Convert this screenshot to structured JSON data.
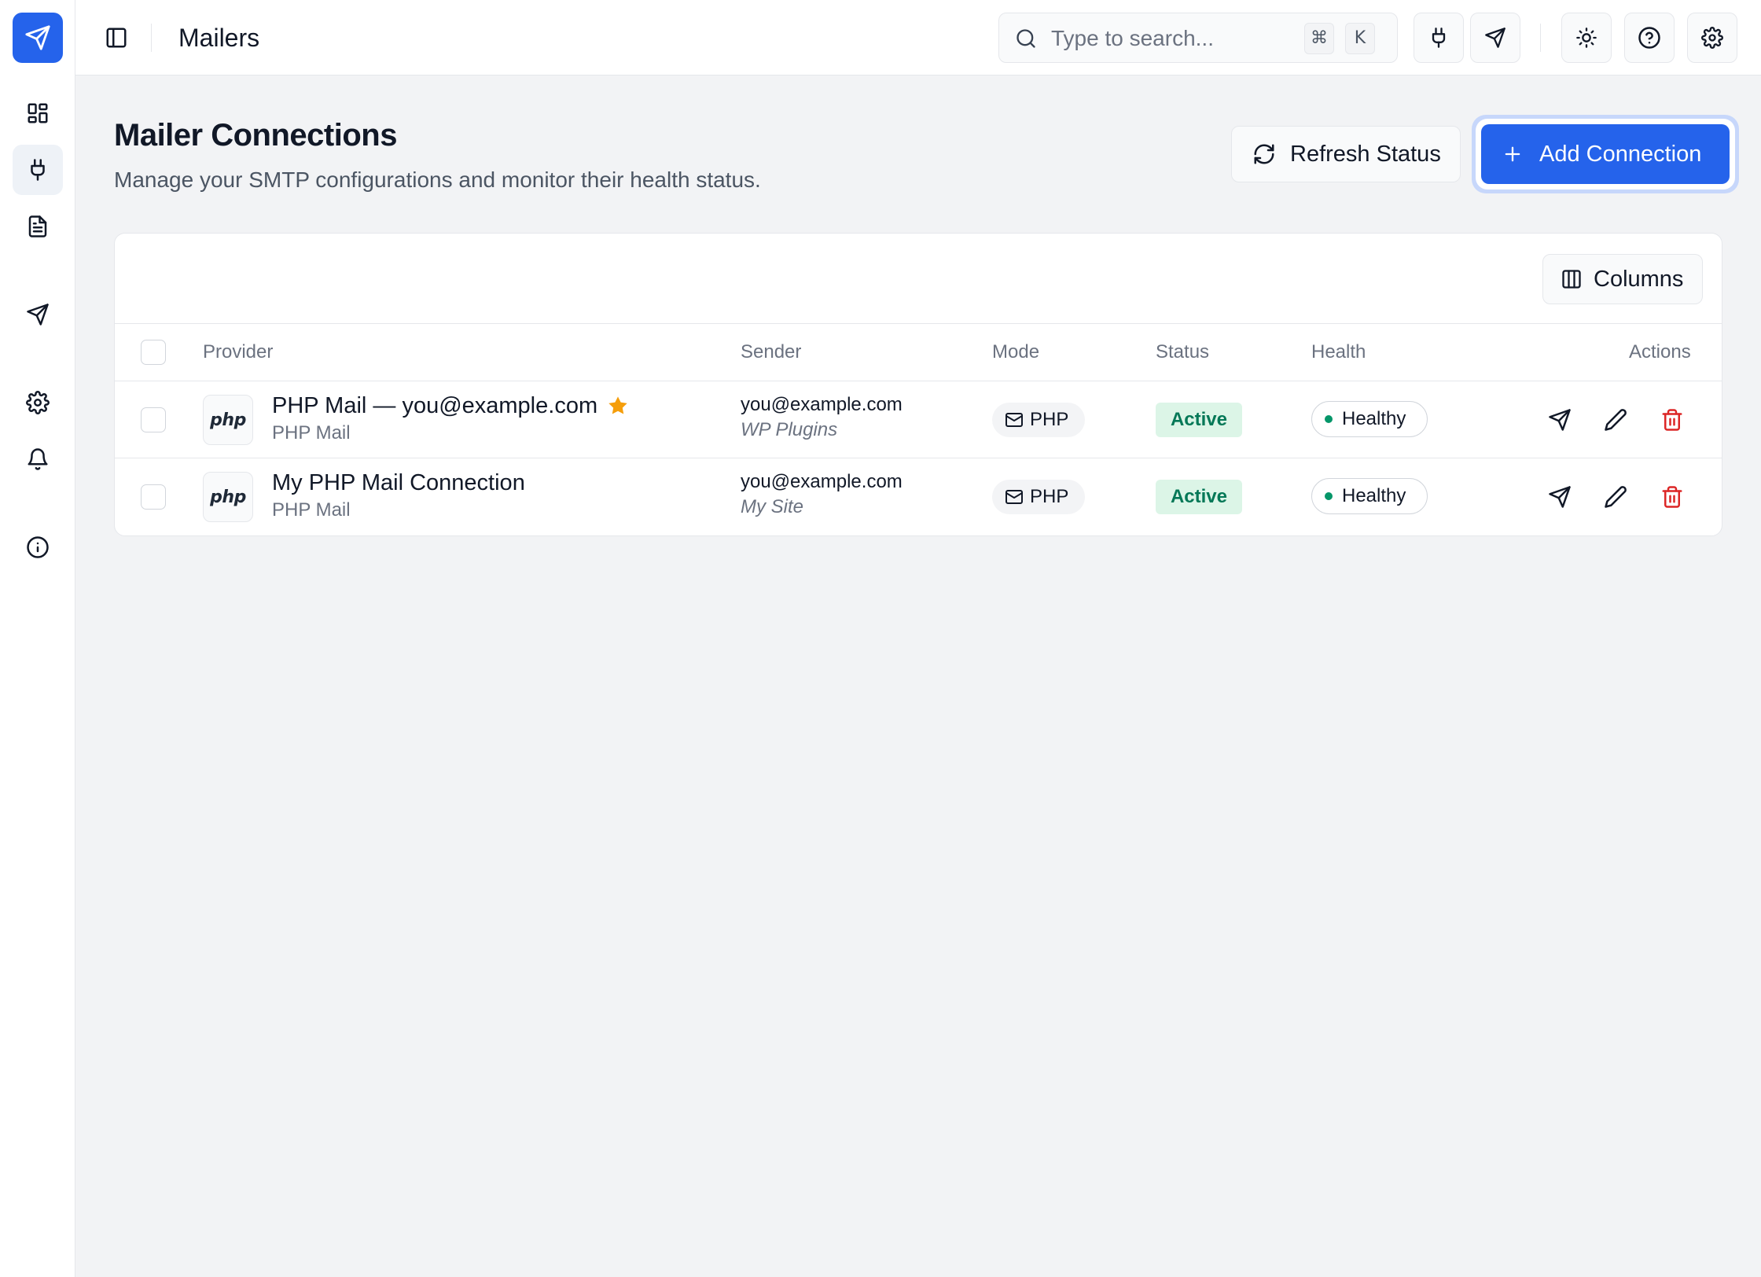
{
  "app": {
    "page_title": "Mailers"
  },
  "sidebar": {
    "items": [
      {
        "name": "dashboard",
        "icon": "dashboard-icon",
        "active": false
      },
      {
        "name": "connections",
        "icon": "plug-icon",
        "active": true
      },
      {
        "name": "logs",
        "icon": "document-icon",
        "active": false
      },
      {
        "name": "send-test",
        "icon": "send-icon",
        "active": false
      },
      {
        "name": "settings",
        "icon": "gear-icon",
        "active": false
      },
      {
        "name": "notifications",
        "icon": "bell-icon",
        "active": false
      },
      {
        "name": "about",
        "icon": "info-icon",
        "active": false
      }
    ]
  },
  "topbar": {
    "search_placeholder": "Type to search...",
    "shortcut_keys": [
      "⌘",
      "K"
    ],
    "buttons": [
      "plug-icon",
      "send-icon",
      "sun-icon",
      "help-icon",
      "gear-icon"
    ]
  },
  "header": {
    "title": "Mailer Connections",
    "subtitle": "Manage your SMTP configurations and monitor their health status.",
    "refresh_label": "Refresh Status",
    "add_label": "Add Connection"
  },
  "table": {
    "columns_button": "Columns",
    "headers": {
      "provider": "Provider",
      "sender": "Sender",
      "mode": "Mode",
      "status": "Status",
      "health": "Health",
      "actions": "Actions"
    },
    "rows": [
      {
        "logo": "php",
        "name": "PHP Mail — you@example.com",
        "starred": true,
        "type": "PHP Mail",
        "sender_email": "you@example.com",
        "sender_site": "WP Plugins",
        "mode": "PHP",
        "status": "Active",
        "health": "Healthy"
      },
      {
        "logo": "php",
        "name": "My PHP Mail Connection",
        "starred": false,
        "type": "PHP Mail",
        "sender_email": "you@example.com",
        "sender_site": "My Site",
        "mode": "PHP",
        "status": "Active",
        "health": "Healthy"
      }
    ]
  },
  "colors": {
    "accent": "#2563eb",
    "status_active_bg": "#dcf5e7",
    "status_active_text": "#047857",
    "healthy_dot": "#059669",
    "delete": "#dc2626",
    "star": "#f59e0b"
  }
}
